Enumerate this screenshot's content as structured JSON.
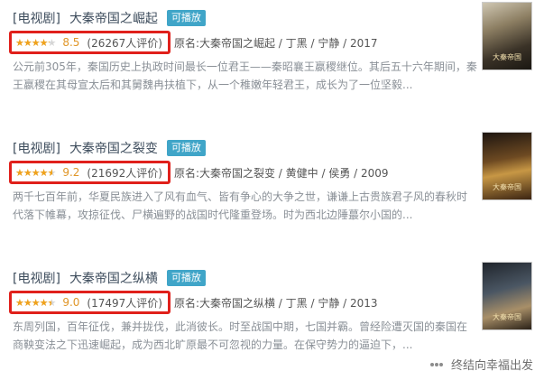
{
  "items": [
    {
      "category": "[电视剧]",
      "title": "大秦帝国之崛起",
      "badge": "可播放",
      "rating": 8.5,
      "score": "8.5",
      "votes": "(26267人评价)",
      "info": "原名:大秦帝国之崛起 / 丁黑 / 宁静 / 2017",
      "desc": "公元前305年，秦国历史上执政时间最长一位君王——秦昭襄王嬴稷继位。其后五十六年期间，秦王嬴稷在其母宣太后和其舅魏冉扶植下，从一个稚嫩年轻君王，成长为了一位坚毅..."
    },
    {
      "category": "[电视剧]",
      "title": "大秦帝国之裂变",
      "badge": "可播放",
      "rating": 9.2,
      "score": "9.2",
      "votes": "(21692人评价)",
      "info": "原名:大秦帝国之裂变 / 黄健中 / 侯勇 / 2009",
      "desc": "两千七百年前，华夏民族进入了风有血气、皆有争心的大争之世，谦谦上古贵族君子风的春秋时代落下帷幕，攻掠征伐、尸横遍野的战国时代隆重登场。时为西北边陲蕞尔小国的..."
    },
    {
      "category": "[电视剧]",
      "title": "大秦帝国之纵横",
      "badge": "可播放",
      "rating": 9.0,
      "score": "9.0",
      "votes": "(17497人评价)",
      "info": "原名:大秦帝国之纵横 / 丁黑 / 宁静 / 2013",
      "desc": "东周列国，百年征伐，兼并拢伐，此消彼长。时至战国中期，七国并霸。曾经险遭灭国的秦国在商鞅变法之下迅速崛起，成为西北旷原最不可忽视的力量。在保守势力的逼迫下，..."
    }
  ],
  "posters": [
    "大秦帝国",
    "大秦帝国",
    "大秦帝国"
  ],
  "watermark": "终结向幸福出发",
  "colors": {
    "rating_border": "#e0201b",
    "badge": "#40a5c8",
    "star": "#f0a21b",
    "score": "#e09628"
  }
}
